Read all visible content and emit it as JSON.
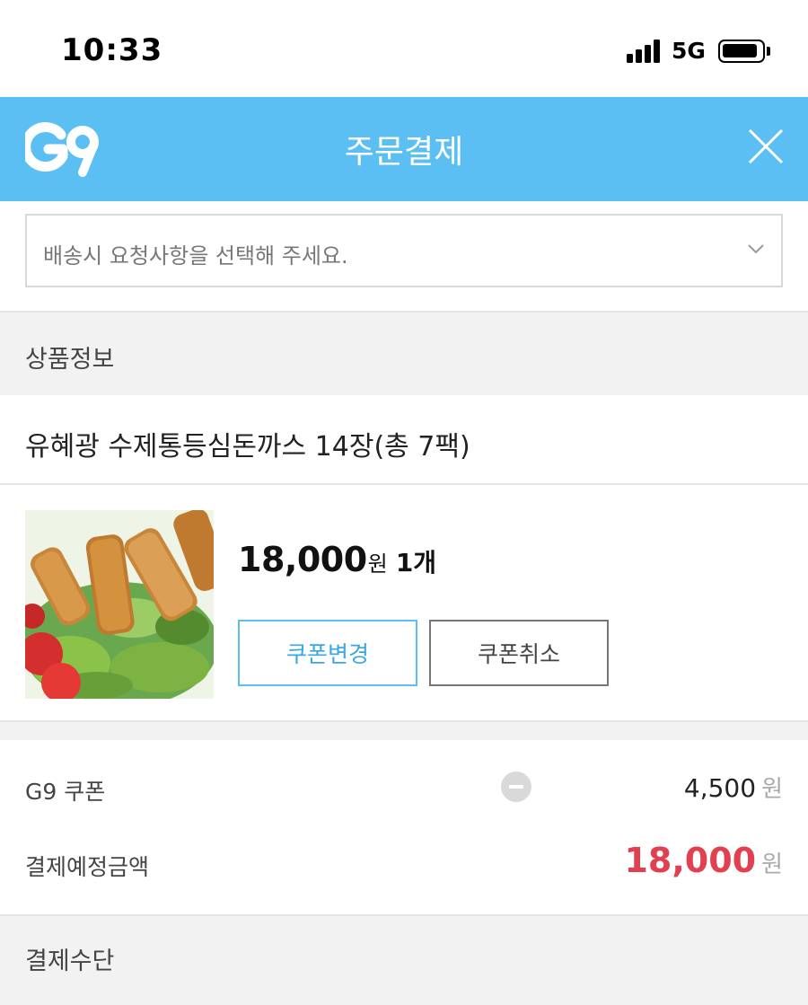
{
  "status_bar": {
    "time": "10:33",
    "network": "5G"
  },
  "header": {
    "logo_text": "G9",
    "title": "주문결제",
    "close_icon": "close-icon"
  },
  "delivery_request": {
    "placeholder": "배송시 요청사항을 선택해 주세요."
  },
  "product_section": {
    "label": "상품정보",
    "product_name": "유혜광 수제통등심돈까스 14장(총 7팩)",
    "price": "18,000",
    "price_unit": "원",
    "quantity": "1개",
    "coupon_change_label": "쿠폰변경",
    "coupon_cancel_label": "쿠폰취소"
  },
  "summary": {
    "coupon_label": "G9 쿠폰",
    "coupon_amount": "4,500",
    "coupon_unit": "원",
    "total_label": "결제예정금액",
    "total_amount": "18,000",
    "total_unit": "원"
  },
  "payment_section": {
    "label": "결제수단"
  },
  "colors": {
    "brand": "#5bbff4",
    "total": "#e0404f"
  }
}
